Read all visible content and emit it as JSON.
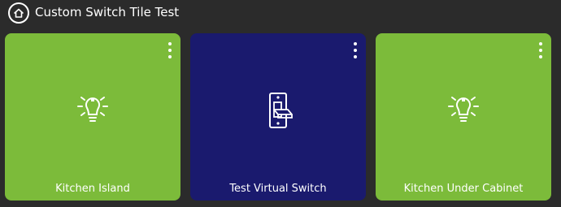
{
  "header": {
    "title": "Custom Switch Tile Test",
    "home_icon": "home-icon"
  },
  "tiles": [
    {
      "label": "Kitchen Island",
      "icon": "light-bulb-icon",
      "state": "on",
      "color": "#7cbb3a"
    },
    {
      "label": "Test Virtual Switch",
      "icon": "light-switch-icon",
      "state": "off",
      "color": "#1a1a6e"
    },
    {
      "label": "Kitchen Under Cabinet",
      "icon": "light-bulb-icon",
      "state": "on",
      "color": "#7cbb3a"
    }
  ],
  "colors": {
    "background": "#2b2b2b",
    "tile_on": "#7cbb3a",
    "tile_off": "#1a1a6e",
    "text": "#ffffff"
  }
}
